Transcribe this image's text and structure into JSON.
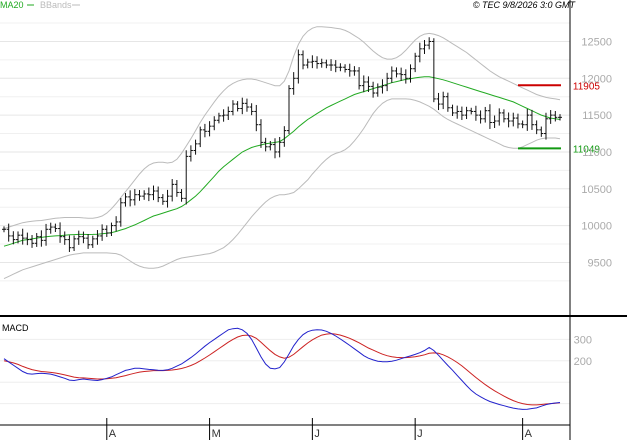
{
  "chart_data": {
    "type": "ohlc",
    "legend": {
      "ma20": "MA20",
      "bbands": "BBands"
    },
    "watermark": "© TEC 9/8/2026 3:0 GMT",
    "colors": {
      "ma20": "#22aa22",
      "bbands": "#bbbbbb",
      "bars": "#111111",
      "resistance": "#cc0000",
      "support": "#119911",
      "macd": "#2222cc",
      "signal": "#cc2222"
    },
    "y_ticks": [
      "12500",
      "12000",
      "11500",
      "11000",
      "10500",
      "10000",
      "9500"
    ],
    "y_tick_values": [
      12500,
      12000,
      11500,
      11000,
      10500,
      10000,
      9500
    ],
    "ylim": [
      8800,
      12900
    ],
    "levels": [
      {
        "label": "11905",
        "value": 11905,
        "color": "#cc0000"
      },
      {
        "label": "11049",
        "value": 11049,
        "color": "#119911"
      }
    ],
    "macd_label": "MACD",
    "macd_ticks": [
      "300",
      "200"
    ],
    "macd_tick_values": [
      300,
      200
    ],
    "macd_ylim": [
      -100,
      400
    ],
    "x_labels": [
      "A",
      "M",
      "J",
      "J",
      "A"
    ],
    "x_label_sessions": [
      22,
      44,
      66,
      88,
      111
    ],
    "session_count": 120,
    "close": [
      9950,
      9860,
      9810,
      9870,
      9830,
      9810,
      9760,
      9850,
      9800,
      9950,
      9980,
      9960,
      9850,
      9810,
      9700,
      9820,
      9850,
      9830,
      9740,
      9820,
      9860,
      9950,
      9900,
      10000,
      10050,
      10310,
      10390,
      10350,
      10420,
      10400,
      10430,
      10420,
      10470,
      10380,
      10330,
      10400,
      10560,
      10450,
      10370,
      10940,
      11020,
      11110,
      11300,
      11280,
      11350,
      11430,
      11490,
      11500,
      11550,
      11650,
      11590,
      11660,
      11610,
      11550,
      11370,
      11130,
      11070,
      11100,
      11000,
      11130,
      11290,
      11860,
      12000,
      12320,
      12180,
      12220,
      12230,
      12200,
      12210,
      12180,
      12180,
      12150,
      12150,
      12120,
      12100,
      12100,
      11900,
      11950,
      11890,
      11800,
      11880,
      11900,
      12000,
      12100,
      12060,
      12050,
      12000,
      12130,
      12300,
      12400,
      12450,
      12500,
      11720,
      11650,
      11750,
      11600,
      11530,
      11550,
      11500,
      11560,
      11550,
      11500,
      11450,
      11560,
      11400,
      11420,
      11530,
      11450,
      11420,
      11460,
      11380,
      11370,
      11500,
      11370,
      11300,
      11250,
      11450,
      11500,
      11470,
      11470
    ],
    "ma20": [
      9720,
      9740,
      9760,
      9780,
      9800,
      9810,
      9820,
      9830,
      9840,
      9850,
      9855,
      9860,
      9865,
      9870,
      9875,
      9878,
      9880,
      9880,
      9879,
      9880,
      9883,
      9890,
      9895,
      9905,
      9920,
      9940,
      9960,
      9985,
      10010,
      10040,
      10070,
      10100,
      10130,
      10150,
      10170,
      10190,
      10210,
      10230,
      10260,
      10300,
      10350,
      10400,
      10460,
      10530,
      10600,
      10670,
      10740,
      10800,
      10850,
      10900,
      10950,
      11000,
      11030,
      11060,
      11080,
      11095,
      11110,
      11120,
      11130,
      11140,
      11180,
      11230,
      11280,
      11340,
      11390,
      11440,
      11480,
      11520,
      11560,
      11600,
      11630,
      11660,
      11690,
      11720,
      11750,
      11780,
      11800,
      11820,
      11840,
      11860,
      11880,
      11900,
      11920,
      11940,
      11955,
      11970,
      11985,
      11995,
      12005,
      12015,
      12020,
      12020,
      12010,
      11995,
      11980,
      11960,
      11940,
      11920,
      11900,
      11880,
      11860,
      11840,
      11820,
      11800,
      11780,
      11760,
      11740,
      11720,
      11700,
      11680,
      11650,
      11620,
      11590,
      11560,
      11530,
      11500,
      11480,
      11460,
      11450,
      11440
    ],
    "bb_upper": [
      9960,
      9980,
      10000,
      10020,
      10040,
      10050,
      10060,
      10065,
      10070,
      10080,
      10090,
      10100,
      10105,
      10110,
      10110,
      10110,
      10110,
      10105,
      10100,
      10100,
      10110,
      10130,
      10170,
      10230,
      10300,
      10380,
      10460,
      10540,
      10620,
      10700,
      10770,
      10820,
      10850,
      10860,
      10860,
      10850,
      10860,
      10900,
      10980,
      11080,
      11180,
      11290,
      11400,
      11500,
      11590,
      11680,
      11760,
      11830,
      11890,
      11930,
      11960,
      11980,
      11990,
      11990,
      11980,
      11960,
      11940,
      11920,
      11900,
      11900,
      11960,
      12100,
      12300,
      12460,
      12570,
      12640,
      12680,
      12700,
      12700,
      12695,
      12690,
      12680,
      12670,
      12650,
      12620,
      12580,
      12540,
      12490,
      12430,
      12370,
      12320,
      12280,
      12260,
      12260,
      12280,
      12320,
      12380,
      12450,
      12520,
      12570,
      12600,
      12610,
      12600,
      12580,
      12550,
      12510,
      12470,
      12430,
      12390,
      12350,
      12300,
      12250,
      12200,
      12150,
      12100,
      12060,
      12020,
      11990,
      11960,
      11930,
      11900,
      11870,
      11840,
      11810,
      11780,
      11760,
      11740,
      11730,
      11720,
      11710
    ],
    "bb_lower": [
      9280,
      9310,
      9340,
      9370,
      9400,
      9420,
      9440,
      9460,
      9480,
      9500,
      9520,
      9540,
      9560,
      9580,
      9600,
      9610,
      9620,
      9630,
      9630,
      9630,
      9630,
      9630,
      9630,
      9625,
      9620,
      9600,
      9560,
      9520,
      9480,
      9450,
      9430,
      9420,
      9420,
      9430,
      9450,
      9480,
      9510,
      9540,
      9560,
      9570,
      9580,
      9590,
      9600,
      9610,
      9620,
      9640,
      9670,
      9700,
      9750,
      9810,
      9880,
      9960,
      10040,
      10120,
      10190,
      10260,
      10320,
      10370,
      10400,
      10420,
      10420,
      10430,
      10450,
      10500,
      10560,
      10620,
      10700,
      10770,
      10840,
      10900,
      10950,
      10980,
      11000,
      11030,
      11080,
      11150,
      11230,
      11320,
      11420,
      11520,
      11600,
      11660,
      11700,
      11720,
      11720,
      11720,
      11720,
      11715,
      11700,
      11680,
      11650,
      11620,
      11580,
      11530,
      11480,
      11440,
      11410,
      11380,
      11350,
      11320,
      11290,
      11260,
      11230,
      11200,
      11170,
      11140,
      11110,
      11080,
      11060,
      11050,
      11050,
      11070,
      11100,
      11130,
      11160,
      11180,
      11190,
      11190,
      11190,
      11180
    ],
    "macd": [
      210,
      195,
      180,
      165,
      150,
      140,
      138,
      140,
      142,
      140,
      138,
      132,
      125,
      118,
      110,
      108,
      112,
      115,
      112,
      110,
      108,
      112,
      118,
      125,
      135,
      145,
      155,
      160,
      165,
      165,
      162,
      160,
      158,
      156,
      155,
      158,
      165,
      175,
      185,
      200,
      215,
      232,
      250,
      268,
      285,
      300,
      315,
      330,
      345,
      350,
      352,
      345,
      328,
      300,
      260,
      218,
      185,
      165,
      162,
      168,
      195,
      232,
      270,
      300,
      322,
      336,
      343,
      345,
      344,
      338,
      328,
      316,
      302,
      287,
      272,
      256,
      240,
      224,
      212,
      204,
      198,
      196,
      196,
      198,
      203,
      210,
      217,
      223,
      230,
      238,
      248,
      262,
      248,
      226,
      202,
      178,
      156,
      132,
      108,
      84,
      62,
      45,
      32,
      20,
      10,
      3,
      -4,
      -10,
      -16,
      -21,
      -25,
      -27,
      -26,
      -23,
      -20,
      -12,
      -5,
      0,
      3,
      5
    ],
    "signal": [
      200,
      196,
      190,
      183,
      174,
      166,
      159,
      154,
      150,
      148,
      146,
      143,
      139,
      134,
      129,
      124,
      121,
      120,
      118,
      117,
      115,
      115,
      116,
      118,
      121,
      126,
      131,
      137,
      142,
      147,
      150,
      152,
      154,
      154,
      154,
      155,
      157,
      160,
      164,
      170,
      178,
      188,
      200,
      213,
      227,
      242,
      257,
      272,
      287,
      300,
      311,
      318,
      320,
      316,
      305,
      287,
      267,
      247,
      230,
      218,
      212,
      217,
      230,
      248,
      266,
      283,
      298,
      310,
      320,
      325,
      327,
      325,
      320,
      313,
      305,
      295,
      284,
      272,
      260,
      250,
      240,
      231,
      224,
      219,
      216,
      215,
      215,
      217,
      219,
      223,
      228,
      235,
      237,
      235,
      228,
      218,
      206,
      192,
      176,
      158,
      140,
      122,
      105,
      89,
      74,
      60,
      47,
      35,
      24,
      14,
      6,
      0,
      -4,
      -6,
      -6,
      -4,
      -2,
      0,
      2,
      4
    ]
  }
}
